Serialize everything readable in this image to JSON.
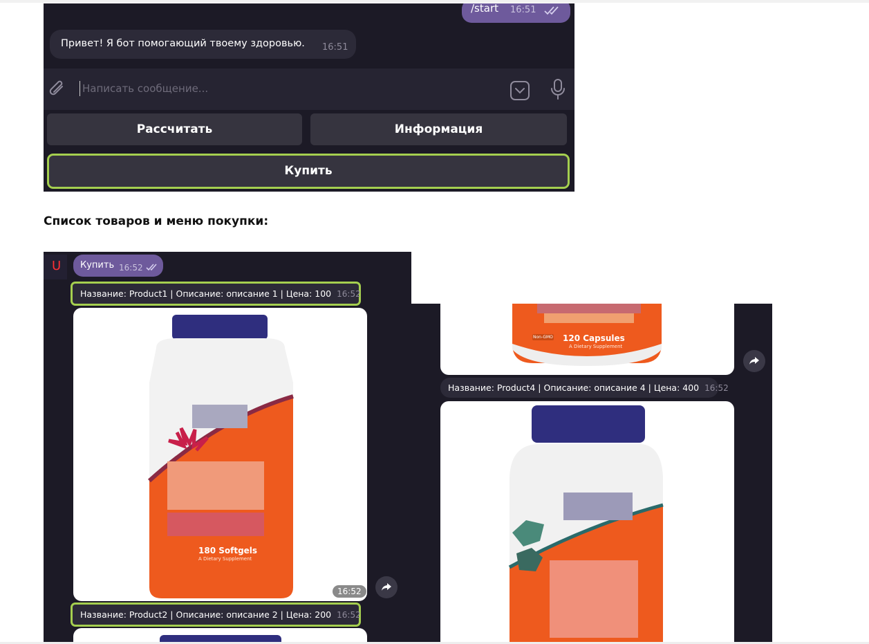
{
  "chat_top": {
    "outgoing": {
      "text": "/start",
      "time": "16:51"
    },
    "incoming": {
      "text": "Привет! Я бот помогающий твоему здоровью.",
      "time": "16:51"
    },
    "input_placeholder": "Написать сообщение...",
    "keyboard": {
      "btn_calc": "Рассчитать",
      "btn_info": "Информация",
      "btn_buy": "Купить"
    }
  },
  "caption": "Список товаров и меню покупки:",
  "chat_products": {
    "avatar_letter": "U",
    "outgoing": {
      "text": "Купить",
      "time": "16:52"
    },
    "product1": {
      "caption": "Название: Product1 | Описание: описание 1 | Цена: 100",
      "time": "16:52",
      "photo_time": "16:52",
      "label": "180 Softgels",
      "sub": "A Dietary Supplement"
    },
    "product2": {
      "caption": "Название: Product2 | Описание: описание 2 | Цена: 200",
      "time": "16:52"
    },
    "product3": {
      "label": "120 Capsules",
      "sub": "A Dietary Supplement",
      "badge": "Non-GMO"
    },
    "product4": {
      "caption": "Название: Product4 | Описание: описание 4 | Цена: 400",
      "time": "16:52"
    }
  },
  "colors": {
    "chat_bg": "#1c1a26",
    "outgoing_bubble": "#6e5a9c",
    "incoming_bubble": "#2c2a38",
    "highlight": "#a5cf4f",
    "bottle_orange": "#ee5a1e",
    "bottle_cap": "#2f2e7e"
  },
  "icons": [
    "paperclip-icon",
    "emoji-icon",
    "microphone-icon",
    "double-check-icon",
    "forward-icon"
  ]
}
